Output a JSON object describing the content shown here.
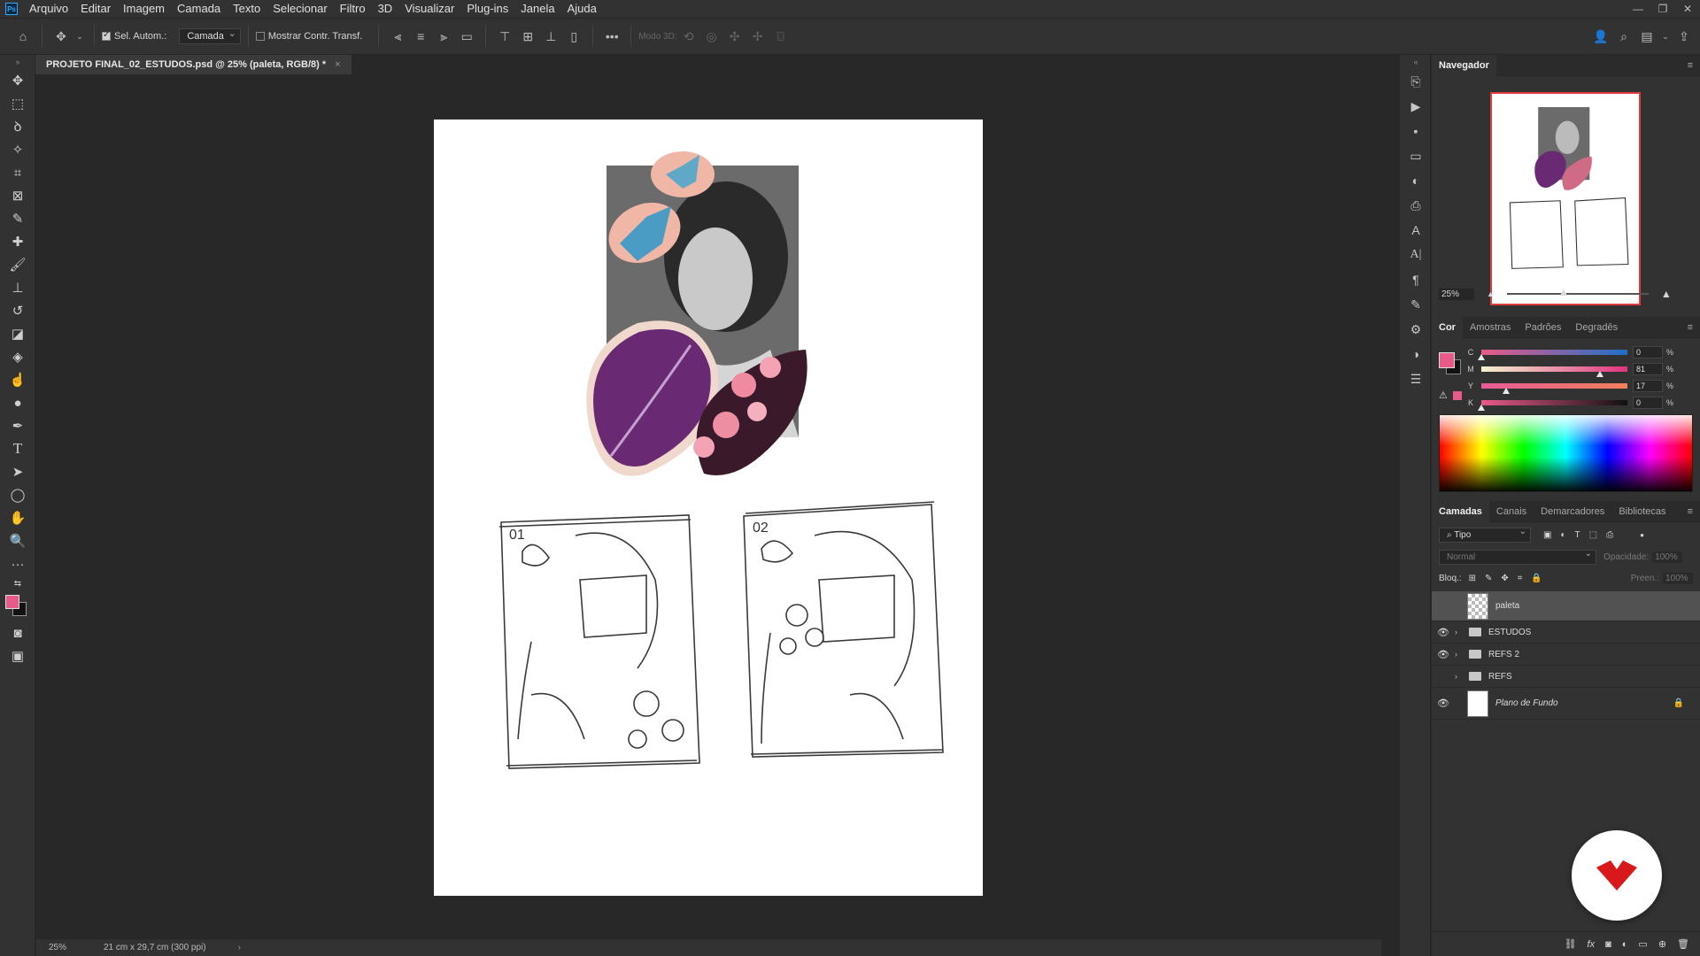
{
  "app": {
    "logo_text": "Ps"
  },
  "menu": [
    "Arquivo",
    "Editar",
    "Imagem",
    "Camada",
    "Texto",
    "Selecionar",
    "Filtro",
    "3D",
    "Visualizar",
    "Plug-ins",
    "Janela",
    "Ajuda"
  ],
  "options_bar": {
    "auto_select_label": "Sel. Autom.:",
    "auto_select_target": "Camada",
    "show_transform_label": "Mostrar Contr. Transf.",
    "mode_3d_label": "Modo 3D:"
  },
  "document_tab": {
    "title": "PROJETO FINAL_02_ESTUDOS.psd @ 25% (paleta, RGB/8) *",
    "close": "×"
  },
  "status_bar": {
    "zoom": "25%",
    "doc_size": "21 cm x 29,7 cm (300 ppi)",
    "arrow": "›"
  },
  "navigator": {
    "title": "Navegador",
    "zoom": "25%"
  },
  "color_panel": {
    "tabs": [
      "Cor",
      "Amostras",
      "Padrões",
      "Degradês"
    ],
    "channels": [
      {
        "label": "C",
        "value": "0",
        "pct": "%",
        "fraction": 0.0
      },
      {
        "label": "M",
        "value": "81",
        "pct": "%",
        "fraction": 0.81
      },
      {
        "label": "Y",
        "value": "17",
        "pct": "%",
        "fraction": 0.17
      },
      {
        "label": "K",
        "value": "0",
        "pct": "%",
        "fraction": 0.0
      }
    ],
    "foreground_color": "#e85a87",
    "background_color": "#111111"
  },
  "layers_panel": {
    "tabs": [
      "Camadas",
      "Canais",
      "Demarcadores",
      "Bibliotecas"
    ],
    "filter_label": "Tipo",
    "blend_mode": "Normal",
    "opacity_label": "Opacidade:",
    "opacity_value": "100%",
    "lock_label": "Bloq.:",
    "fill_label": "Preen.:",
    "fill_value": "100%",
    "layers": [
      {
        "name": "paleta",
        "type": "layer",
        "visible": false,
        "selected": true
      },
      {
        "name": "ESTUDOS",
        "type": "group",
        "visible": true
      },
      {
        "name": "REFS 2",
        "type": "group",
        "visible": true
      },
      {
        "name": "REFS",
        "type": "group",
        "visible": false
      },
      {
        "name": "Plano de Fundo",
        "type": "background",
        "visible": true,
        "locked": true
      }
    ]
  },
  "artwork": {
    "sketch_1_label": "01",
    "sketch_2_label": "02"
  },
  "colors": {
    "accent": "#31a8ff",
    "brand_logo": "#d7191c",
    "foreground": "#e85a87"
  }
}
